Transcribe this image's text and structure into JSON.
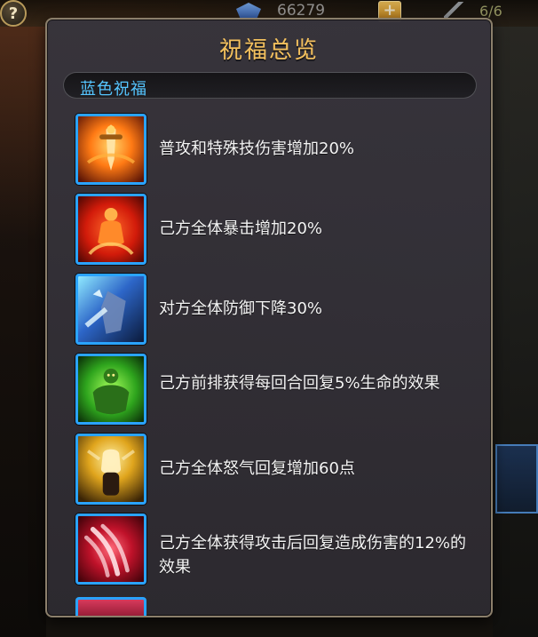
{
  "hud": {
    "help_icon": "?",
    "gem_value": "66279",
    "plus_label": "+",
    "energy_value": "6/6"
  },
  "modal": {
    "title": "祝福总览",
    "section": {
      "label": "蓝色祝福"
    },
    "items": [
      {
        "icon": "sword-icon",
        "text": "普攻和特殊技伤害增加20%"
      },
      {
        "icon": "flame-body-icon",
        "text": "己方全体暴击增加20%"
      },
      {
        "icon": "shield-break-icon",
        "text": "对方全体防御下降30%"
      },
      {
        "icon": "green-giant-icon",
        "text": "己方前排获得每回合回复5%生命的效果"
      },
      {
        "icon": "fist-icon",
        "text": "己方全体怒气回复增加60点"
      },
      {
        "icon": "claw-slash-icon",
        "text": "己方全体获得攻击后回复造成伤害的12%的效果"
      }
    ]
  },
  "colors": {
    "title": "#f3c05d",
    "section_label": "#55c5ff",
    "icon_border": "#2aa3ff",
    "text": "#f4f4f4"
  }
}
